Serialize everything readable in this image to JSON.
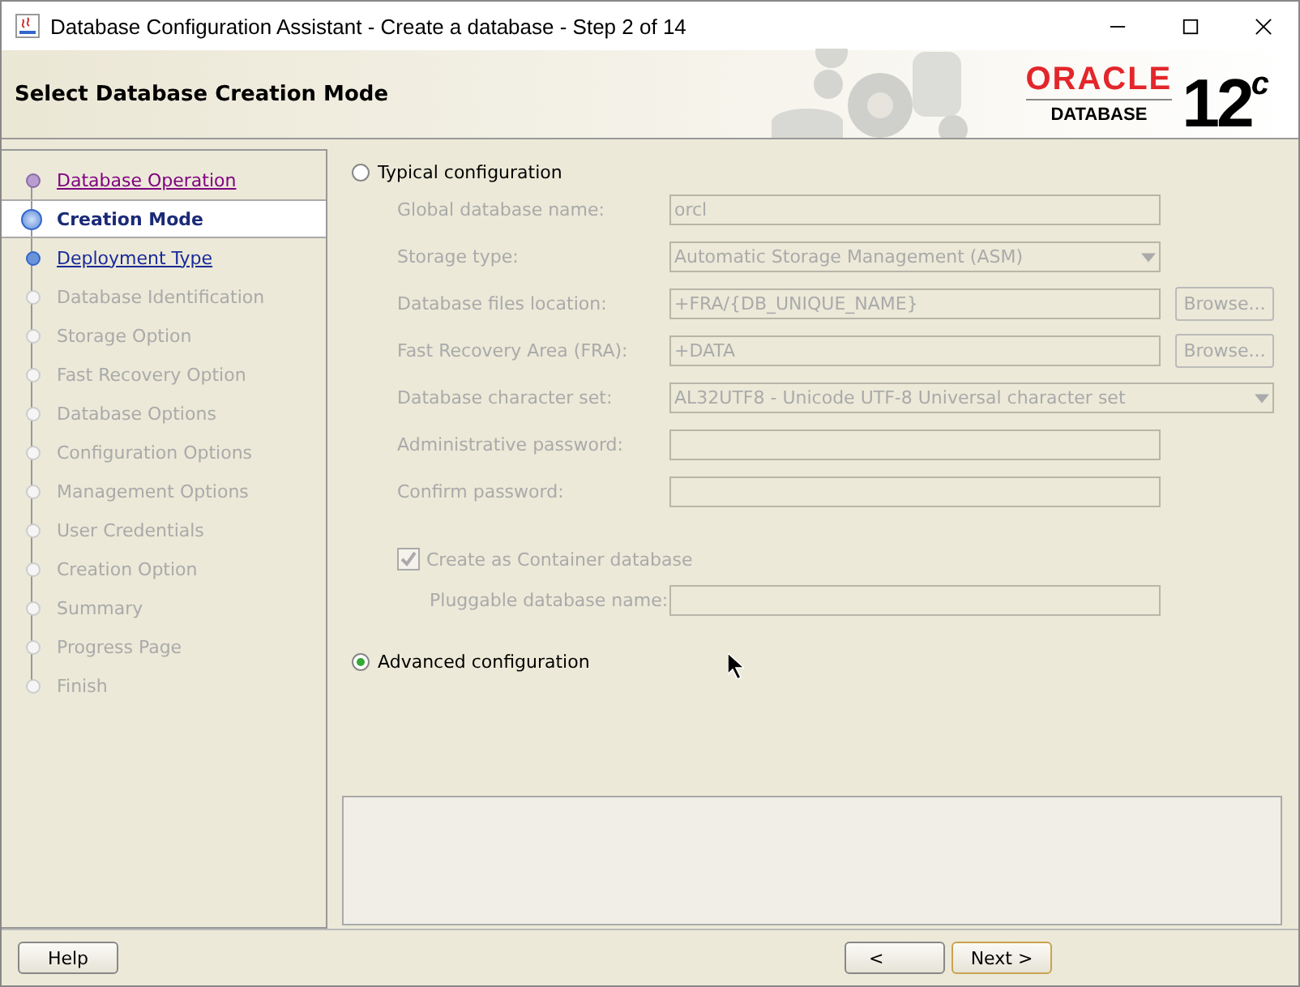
{
  "window": {
    "title": "Database Configuration Assistant - Create a database - Step 2 of 14"
  },
  "header": {
    "title": "Select Database Creation Mode",
    "logo": {
      "brand": "ORACLE",
      "product": "DATABASE",
      "version": "12$^{c}$"
    }
  },
  "steps": [
    {
      "label": "Database Operation",
      "kind": "visited",
      "selected": false
    },
    {
      "label": "Creation Mode",
      "kind": "current",
      "selected": true
    },
    {
      "label": "Deployment Type",
      "kind": "available",
      "selected": false
    },
    {
      "label": "Database Identification",
      "kind": "disabled",
      "selected": false
    },
    {
      "label": "Storage Option",
      "kind": "disabled",
      "selected": false
    },
    {
      "label": "Fast Recovery Option",
      "kind": "disabled",
      "selected": false
    },
    {
      "label": "Database Options",
      "kind": "disabled",
      "selected": false
    },
    {
      "label": "Configuration Options",
      "kind": "disabled",
      "selected": false
    },
    {
      "label": "Management Options",
      "kind": "disabled",
      "selected": false
    },
    {
      "label": "User Credentials",
      "kind": "disabled",
      "selected": false
    },
    {
      "label": "Creation Option",
      "kind": "disabled",
      "selected": false
    },
    {
      "label": "Summary",
      "kind": "disabled",
      "selected": false
    },
    {
      "label": "Progress Page",
      "kind": "disabled",
      "selected": false
    },
    {
      "label": "Finish",
      "kind": "disabled",
      "selected": false
    }
  ],
  "typical": {
    "label": "Typical configuration",
    "selected": false,
    "disabled": true,
    "fields": [
      {
        "kind": "text",
        "label": "Global database name:",
        "value": "orcl"
      },
      {
        "kind": "select",
        "label": "Storage type:",
        "value": "Automatic Storage Management (ASM)"
      },
      {
        "kind": "browse",
        "label": "Database files location:",
        "value": "+FRA/{DB_UNIQUE_NAME}",
        "button": "Browse..."
      },
      {
        "kind": "browse",
        "label": "Fast Recovery Area (FRA):",
        "value": "+DATA",
        "button": "Browse..."
      },
      {
        "kind": "wideselect",
        "label": "Database character set:",
        "value": "AL32UTF8 - Unicode UTF-8 Universal character set"
      },
      {
        "kind": "text",
        "label": "Administrative password:"
      },
      {
        "kind": "text",
        "label": "Confirm password:"
      }
    ],
    "container": {
      "label": "Create as Container database",
      "checked": true
    },
    "pluggable": {
      "label": "Pluggable database name:"
    }
  },
  "advanced": {
    "label": "Advanced configuration",
    "selected": true
  },
  "buttons": {
    "help": "Help",
    "back": "<",
    "next": "Next >"
  }
}
